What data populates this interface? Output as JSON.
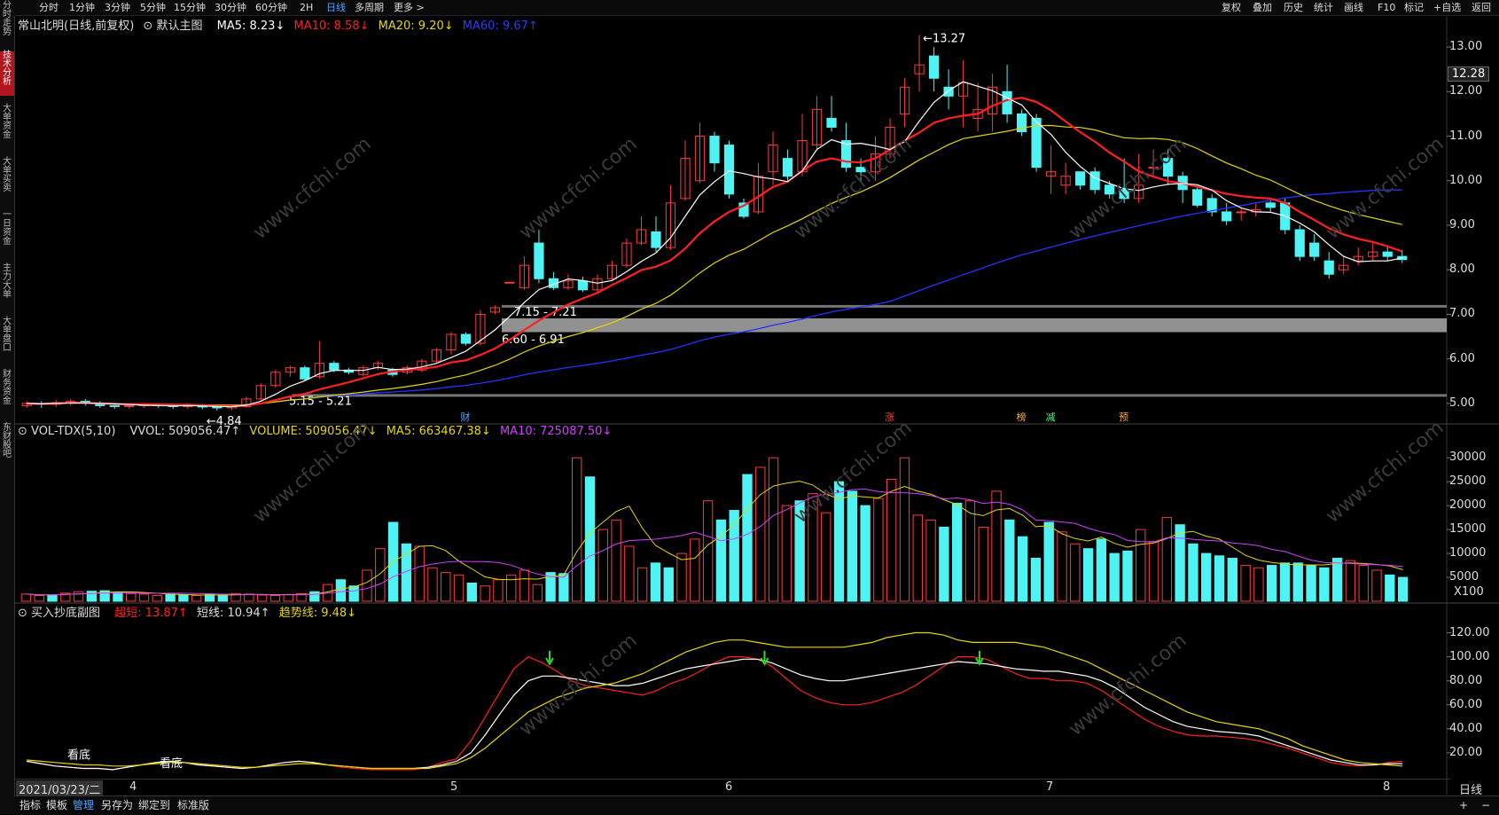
{
  "sidebar": {
    "items": [
      {
        "label": "分时走势",
        "active": false
      },
      {
        "label": "技术分析",
        "active": true
      },
      {
        "label": "大单资金",
        "active": false
      },
      {
        "label": "大单买卖",
        "active": false
      },
      {
        "label": "一日资金",
        "active": false
      },
      {
        "label": "主力大单",
        "active": false
      },
      {
        "label": "大单盘口",
        "active": false
      },
      {
        "label": "财务资金",
        "active": false
      },
      {
        "label": "东财股吧",
        "active": false
      }
    ]
  },
  "topbar": {
    "timeframes": [
      "分时",
      "1分钟",
      "3分钟",
      "5分钟",
      "15分钟",
      "30分钟",
      "60分钟",
      "2H",
      "日线",
      "多周期",
      "更多 >"
    ],
    "active_timeframe": "日线",
    "right_buttons": [
      "复权",
      "叠加",
      "历史",
      "统计",
      "画线",
      "F10",
      "标记",
      "+自选",
      "返回"
    ]
  },
  "main_chart": {
    "stock_title": "常山北明(日线,前复权)",
    "template": "默认主图",
    "ma5": "MA5: 8.23↓",
    "ma10": "MA10: 8.58↓",
    "ma20": "MA20: 9.20↓",
    "ma60": "MA60: 9.67↑",
    "peak_label": "13.27",
    "low_label": "4.84",
    "current_price": "12.28",
    "zones": [
      "7.15 - 7.21",
      "6.60 - 6.91",
      "5.15 - 5.21"
    ],
    "event_markers": [
      "财",
      "涨",
      "榜",
      "减",
      "预"
    ],
    "y_ticks": [
      "13.00",
      "12.00",
      "11.00",
      "10.00",
      "9.00",
      "8.00",
      "7.00",
      "6.00",
      "5.00"
    ],
    "colors": {
      "up": "#ff3b3b",
      "down": "#4ff3f3",
      "ma5": "#ffffff",
      "ma10": "#ff2020",
      "ma20": "#e6d600",
      "ma60": "#2233ff"
    }
  },
  "volume_chart": {
    "indicator": "VOL-TDX(5,10)",
    "vvol": "VVOL: 509056.47↑",
    "volume": "VOLUME: 509056.47↓",
    "ma5": "MA5: 663467.38↓",
    "ma10": "MA10: 725087.50↓",
    "y_ticks": [
      "30000",
      "25000",
      "20000",
      "15000",
      "10000",
      "5000"
    ],
    "unit": "X100"
  },
  "indicator_chart": {
    "name": "买入抄底副图",
    "super_short": "超短: 13.87↑",
    "short": "短线: 10.94↑",
    "trend": "趋势线: 9.48↓",
    "labels": [
      "看底",
      "看底"
    ],
    "y_ticks": [
      "120.00",
      "100.00",
      "80.00",
      "60.00",
      "40.00",
      "20.00"
    ]
  },
  "x_axis": {
    "date_label": "2021/03/23/二",
    "months": [
      "4",
      "5",
      "6",
      "7",
      "8"
    ],
    "period": "日线"
  },
  "bottombar": {
    "items": [
      "指标",
      "模板",
      "管理",
      "另存为",
      "绑定到",
      "标准版"
    ],
    "active": "管理"
  },
  "watermark": "www.cfchi.com",
  "chart_data": [
    {
      "type": "candlestick",
      "title": "常山北明(日线,前复权)",
      "ylim": [
        4.6,
        13.3
      ],
      "candles": [
        [
          4.95,
          5.0,
          4.9,
          5.05
        ],
        [
          5.0,
          4.98,
          4.9,
          5.05
        ],
        [
          4.98,
          5.02,
          4.92,
          5.08
        ],
        [
          5.02,
          5.05,
          4.95,
          5.1
        ],
        [
          5.05,
          5.0,
          4.95,
          5.1
        ],
        [
          5.0,
          4.95,
          4.9,
          5.05
        ],
        [
          4.95,
          4.93,
          4.88,
          5.0
        ],
        [
          4.93,
          4.95,
          4.88,
          5.0
        ],
        [
          4.95,
          4.97,
          4.9,
          5.02
        ],
        [
          4.97,
          4.95,
          4.9,
          5.0
        ],
        [
          4.95,
          4.93,
          4.88,
          5.0
        ],
        [
          4.93,
          4.95,
          4.88,
          5.0
        ],
        [
          4.95,
          4.92,
          4.87,
          4.98
        ],
        [
          4.92,
          4.9,
          4.84,
          4.96
        ],
        [
          4.9,
          4.93,
          4.85,
          4.98
        ],
        [
          4.93,
          5.1,
          4.9,
          5.15
        ],
        [
          5.1,
          5.4,
          5.05,
          5.45
        ],
        [
          5.4,
          5.7,
          5.35,
          5.75
        ],
        [
          5.7,
          5.8,
          5.6,
          5.85
        ],
        [
          5.8,
          5.55,
          5.5,
          5.85
        ],
        [
          5.6,
          5.9,
          5.55,
          6.4
        ],
        [
          5.9,
          5.75,
          5.7,
          5.95
        ],
        [
          5.75,
          5.7,
          5.65,
          5.8
        ],
        [
          5.65,
          5.8,
          5.6,
          5.85
        ],
        [
          5.8,
          5.9,
          5.75,
          5.95
        ],
        [
          5.75,
          5.65,
          5.6,
          5.8
        ],
        [
          5.7,
          5.8,
          5.65,
          5.85
        ],
        [
          5.75,
          5.95,
          5.7,
          6.0
        ],
        [
          5.95,
          6.2,
          5.9,
          6.25
        ],
        [
          6.2,
          6.55,
          6.1,
          6.6
        ],
        [
          6.55,
          6.35,
          6.3,
          6.6
        ],
        [
          6.35,
          7.0,
          6.3,
          7.1
        ],
        [
          7.05,
          7.15,
          7.0,
          7.2
        ],
        [
          7.7,
          7.72,
          7.7,
          7.72
        ],
        [
          7.6,
          8.1,
          7.55,
          8.3
        ],
        [
          8.6,
          7.8,
          7.7,
          8.9
        ],
        [
          7.8,
          7.6,
          7.55,
          7.95
        ],
        [
          7.6,
          7.75,
          7.55,
          7.9
        ],
        [
          7.75,
          7.55,
          7.5,
          7.85
        ],
        [
          7.55,
          7.8,
          7.5,
          7.9
        ],
        [
          7.8,
          8.1,
          7.75,
          8.2
        ],
        [
          8.1,
          8.6,
          8.05,
          8.7
        ],
        [
          8.6,
          8.9,
          8.55,
          9.2
        ],
        [
          8.85,
          8.5,
          8.4,
          9.2
        ],
        [
          8.5,
          9.5,
          8.45,
          9.9
        ],
        [
          9.6,
          10.5,
          9.55,
          10.9
        ],
        [
          10.0,
          11.0,
          9.95,
          11.3
        ],
        [
          11.0,
          10.4,
          10.2,
          11.1
        ],
        [
          10.8,
          9.7,
          9.6,
          10.9
        ],
        [
          9.5,
          9.2,
          9.15,
          9.6
        ],
        [
          9.3,
          10.1,
          9.25,
          10.4
        ],
        [
          10.2,
          10.8,
          9.9,
          11.1
        ],
        [
          10.5,
          10.1,
          10.0,
          10.7
        ],
        [
          10.2,
          10.9,
          10.1,
          11.5
        ],
        [
          10.8,
          11.6,
          10.7,
          11.9
        ],
        [
          11.4,
          11.2,
          11.1,
          11.9
        ],
        [
          10.9,
          10.3,
          10.2,
          11.3
        ],
        [
          10.3,
          10.2,
          10.0,
          10.5
        ],
        [
          10.2,
          10.6,
          10.0,
          11.0
        ],
        [
          10.6,
          11.2,
          10.5,
          11.4
        ],
        [
          11.5,
          12.1,
          11.2,
          12.3
        ],
        [
          12.4,
          12.6,
          12.0,
          13.27
        ],
        [
          12.8,
          12.3,
          12.0,
          13.0
        ],
        [
          12.1,
          11.9,
          11.6,
          12.5
        ],
        [
          11.9,
          12.2,
          11.2,
          12.7
        ],
        [
          11.4,
          11.6,
          11.1,
          12.2
        ],
        [
          11.5,
          12.1,
          11.1,
          12.4
        ],
        [
          12.0,
          11.5,
          11.3,
          12.6
        ],
        [
          11.5,
          11.1,
          11.0,
          11.6
        ],
        [
          11.4,
          10.3,
          10.2,
          11.5
        ],
        [
          10.1,
          10.2,
          9.7,
          10.8
        ],
        [
          9.9,
          10.1,
          9.7,
          10.4
        ],
        [
          10.2,
          9.9,
          9.8,
          10.2
        ],
        [
          10.2,
          9.8,
          9.7,
          10.3
        ],
        [
          9.9,
          9.7,
          9.6,
          10.0
        ],
        [
          9.8,
          9.6,
          9.5,
          10.5
        ],
        [
          9.6,
          9.9,
          9.5,
          10.6
        ],
        [
          10.3,
          10.3,
          10.1,
          10.7
        ],
        [
          10.5,
          10.1,
          9.9,
          10.7
        ],
        [
          10.1,
          9.8,
          9.5,
          10.2
        ],
        [
          9.8,
          9.45,
          9.4,
          9.9
        ],
        [
          9.6,
          9.3,
          9.2,
          9.7
        ],
        [
          9.3,
          9.1,
          9.0,
          9.5
        ],
        [
          9.3,
          9.3,
          9.1,
          9.4
        ],
        [
          9.3,
          9.35,
          9.2,
          9.5
        ],
        [
          9.5,
          9.4,
          9.3,
          9.6
        ],
        [
          9.5,
          8.9,
          8.8,
          9.6
        ],
        [
          8.9,
          8.3,
          8.2,
          9.0
        ],
        [
          8.6,
          8.3,
          8.2,
          8.8
        ],
        [
          8.2,
          7.9,
          7.8,
          8.4
        ],
        [
          8.0,
          8.1,
          7.9,
          8.3
        ],
        [
          8.2,
          8.3,
          8.1,
          8.5
        ],
        [
          8.3,
          8.4,
          8.2,
          8.6
        ],
        [
          8.4,
          8.3,
          8.2,
          8.5
        ],
        [
          8.3,
          8.23,
          8.15,
          8.45
        ]
      ]
    },
    {
      "type": "bar",
      "title": "VOL-TDX(5,10)",
      "ylim": [
        0,
        33000
      ],
      "values": [
        1500,
        1200,
        1300,
        1700,
        2000,
        2100,
        2200,
        1800,
        1600,
        1500,
        1200,
        1400,
        1300,
        1200,
        1400,
        1300,
        1600,
        1500,
        1300,
        1200,
        1400,
        1600,
        2000,
        3500,
        4500,
        3200,
        6500,
        11000,
        16500,
        12000,
        11500,
        7000,
        6000,
        5500,
        3800,
        3200,
        4500,
        5500,
        6500,
        3500,
        6000,
        5800,
        30000,
        26000,
        15000,
        17000,
        11500,
        7000,
        8000,
        7000,
        10000,
        13000,
        21000,
        17000,
        19000,
        26500,
        28000,
        30000,
        20000,
        21000,
        22500,
        18500,
        25000,
        23000,
        20000,
        21500,
        25500,
        30000,
        18000,
        17000,
        15500,
        20500,
        21000,
        15500,
        23000,
        17000,
        13500,
        9000,
        16500,
        14500,
        12000,
        11000,
        13000,
        10000,
        10500,
        15000,
        12500,
        17500,
        16000,
        12000,
        10000,
        9500,
        9000,
        7500,
        7000,
        7500,
        8000,
        8000,
        7500,
        7000,
        9000,
        8500,
        7500,
        6500,
        5500,
        5000
      ],
      "ma5_label": "MA5: 663467.38",
      "ma10_label": "MA10: 725087.50"
    },
    {
      "type": "line",
      "title": "买入抄底副图",
      "ylim": [
        0,
        130
      ],
      "series": [
        {
          "name": "超短",
          "values": [
            13,
            11,
            9,
            8,
            7,
            7,
            6,
            8,
            10,
            12,
            13,
            12,
            10,
            9,
            8,
            7,
            8,
            10,
            12,
            13,
            12,
            10,
            8,
            7,
            6,
            6,
            6,
            6,
            8,
            12,
            15,
            30,
            50,
            70,
            90,
            100,
            95,
            88,
            80,
            76,
            74,
            72,
            70,
            68,
            72,
            78,
            82,
            88,
            95,
            100,
            100,
            98,
            92,
            82,
            72,
            66,
            62,
            60,
            60,
            62,
            66,
            70,
            76,
            84,
            92,
            100,
            100,
            98,
            92,
            86,
            82,
            82,
            80,
            80,
            78,
            72,
            64,
            56,
            48,
            42,
            38,
            35,
            34,
            34,
            33,
            32,
            30,
            27,
            24,
            20,
            16,
            12,
            10,
            9,
            10,
            12,
            13
          ]
        },
        {
          "name": "短线",
          "values": [
            13,
            11,
            9,
            8,
            7,
            7,
            6,
            8,
            10,
            12,
            13,
            12,
            10,
            9,
            8,
            7,
            8,
            10,
            12,
            13,
            12,
            10,
            9,
            8,
            7,
            7,
            7,
            7,
            8,
            10,
            13,
            20,
            35,
            52,
            68,
            80,
            84,
            84,
            82,
            80,
            78,
            76,
            76,
            78,
            82,
            86,
            90,
            92,
            94,
            96,
            98,
            98,
            95,
            90,
            85,
            82,
            80,
            80,
            82,
            84,
            86,
            88,
            90,
            92,
            94,
            96,
            95,
            94,
            92,
            90,
            89,
            88,
            88,
            86,
            84,
            80,
            74,
            66,
            58,
            52,
            46,
            42,
            40,
            38,
            37,
            36,
            34,
            30,
            26,
            22,
            18,
            14,
            12,
            10,
            10,
            11,
            11
          ]
        },
        {
          "name": "趋势线",
          "values": [
            14,
            13,
            12,
            11,
            10,
            10,
            9,
            9,
            10,
            11,
            12,
            12,
            11,
            10,
            9,
            8,
            8,
            9,
            10,
            11,
            11,
            10,
            9,
            8,
            7,
            7,
            7,
            7,
            7,
            9,
            11,
            16,
            24,
            34,
            44,
            54,
            60,
            66,
            70,
            74,
            76,
            78,
            82,
            86,
            92,
            98,
            104,
            108,
            112,
            114,
            114,
            112,
            110,
            108,
            108,
            108,
            108,
            108,
            110,
            112,
            116,
            118,
            120,
            120,
            118,
            114,
            112,
            112,
            112,
            112,
            110,
            108,
            104,
            100,
            96,
            90,
            84,
            78,
            72,
            66,
            60,
            54,
            50,
            46,
            44,
            42,
            40,
            36,
            32,
            26,
            22,
            18,
            14,
            12,
            11,
            10,
            9
          ]
        }
      ]
    }
  ]
}
